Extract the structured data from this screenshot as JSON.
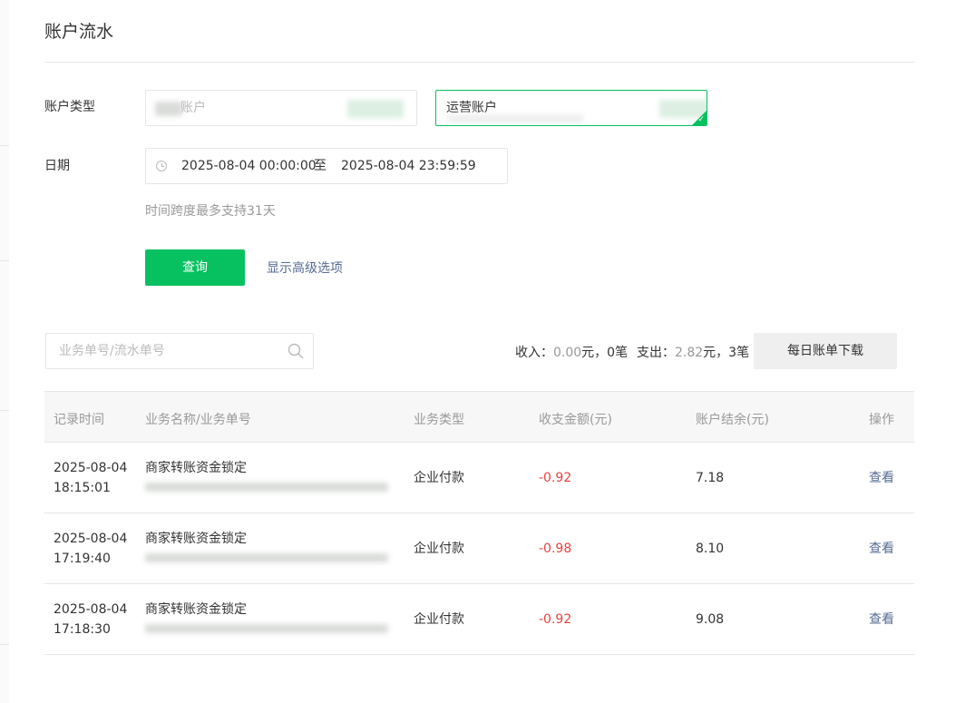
{
  "page": {
    "title": "账户流水"
  },
  "filters": {
    "account_type_label": "账户类型",
    "account_options": [
      {
        "label": "账户",
        "selected": false
      },
      {
        "label": "运营账户",
        "selected": true
      }
    ],
    "date_label": "日期",
    "date_start": "2025-08-04 00:00:00",
    "date_separator": "至",
    "date_end": "2025-08-04 23:59:59",
    "hint": "时间跨度最多支持31天",
    "query_label": "查询",
    "advanced_label": "显示高级选项"
  },
  "toolbar": {
    "search_placeholder": "业务单号/流水单号",
    "income_label": "收入：",
    "income_amount": "0.00",
    "income_unit": "元，",
    "income_count": "0笔",
    "expense_label": "支出：",
    "expense_amount": "2.82",
    "expense_unit": "元，",
    "expense_count": "3笔",
    "download_label": "每日账单下载"
  },
  "table": {
    "headers": [
      "记录时间",
      "业务名称/业务单号",
      "业务类型",
      "收支金额(元)",
      "账户结余(元)",
      "操作"
    ],
    "rows": [
      {
        "date": "2025-08-04",
        "time": "18:15:01",
        "name": "商家转账资金锁定",
        "type": "企业付款",
        "amount": "-0.92",
        "balance": "7.18",
        "action": "查看"
      },
      {
        "date": "2025-08-04",
        "time": "17:19:40",
        "name": "商家转账资金锁定",
        "type": "企业付款",
        "amount": "-0.98",
        "balance": "8.10",
        "action": "查看"
      },
      {
        "date": "2025-08-04",
        "time": "17:18:30",
        "name": "商家转账资金锁定",
        "type": "企业付款",
        "amount": "-0.92",
        "balance": "9.08",
        "action": "查看"
      }
    ]
  },
  "colors": {
    "accent": "#07c160",
    "link": "#576b95",
    "negative": "#e64340",
    "muted": "#999999"
  }
}
